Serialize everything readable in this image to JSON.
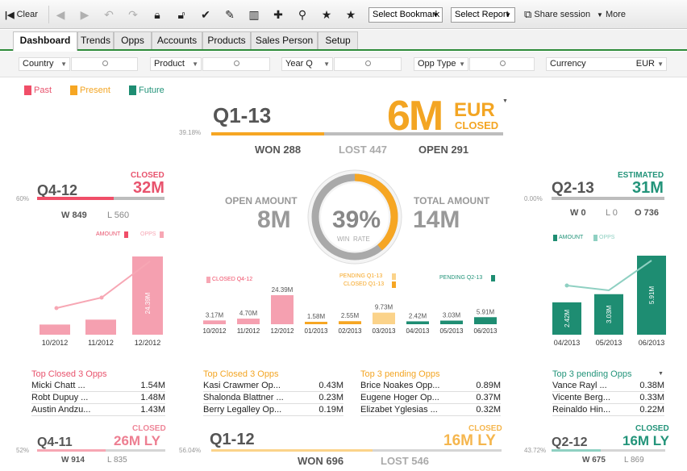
{
  "toolbar": {
    "clear": "Clear",
    "bookmark": "Select Bookmark",
    "report": "Select Report",
    "share": "Share session",
    "more": "More"
  },
  "tabs": [
    "Dashboard",
    "Trends",
    "Opps",
    "Accounts",
    "Products",
    "Sales Person",
    "Setup"
  ],
  "filters": {
    "country": "Country",
    "product": "Product",
    "year": "Year Q",
    "opptype": "Opp Type",
    "currency": "Currency",
    "currency_val": "EUR"
  },
  "legend": {
    "past": "Past",
    "present": "Present",
    "future": "Future",
    "past_color": "#f04e68",
    "present_color": "#f6a623",
    "future_color": "#1e8d72"
  },
  "center": {
    "q": "Q1-13",
    "pct": "39.18%",
    "amount": "6M",
    "cur": "EUR",
    "status": "CLOSED",
    "won": "WON 288",
    "lost": "LOST 447",
    "open": "OPEN 291",
    "open_label": "OPEN AMOUNT",
    "open_val": "8M",
    "total_label": "TOTAL AMOUNT",
    "total_val": "14M",
    "win": "39%",
    "win_rate": "WIN  RATE"
  },
  "left": {
    "q": "Q4-12",
    "pct": "60%",
    "status": "CLOSED",
    "amount": "32M",
    "w": "W 849",
    "l": "L 560",
    "amount_lbl": "AMOUNT",
    "opps_lbl": "OPPS"
  },
  "right": {
    "q": "Q2-13",
    "pct": "0.00%",
    "status": "ESTIMATED",
    "amount": "31M",
    "w": "W 0",
    "l": "L 0",
    "o": "O 736",
    "amount_lbl": "AMOUNT",
    "opps_lbl": "OPPS"
  },
  "left_chart": {
    "categories": [
      "10/2012",
      "11/2012",
      "12/2012"
    ],
    "values": [
      3.17,
      4.7,
      24.39
    ],
    "label": "24.39M"
  },
  "right_chart": {
    "categories": [
      "04/2013",
      "05/2013",
      "06/2013"
    ],
    "values": [
      2.42,
      3.03,
      5.91
    ],
    "labels": [
      "2.42M",
      "3.03M",
      "5.91M"
    ]
  },
  "mid_chart": {
    "closed_q4": "CLOSED Q4-12",
    "pending_q1": "PENDING Q1-13",
    "closed_q1": "CLOSED Q1-13",
    "pending_q2": "PENDING Q2-13",
    "categories": [
      "10/2012",
      "11/2012",
      "12/2012",
      "01/2013",
      "02/2013",
      "03/2013",
      "04/2013",
      "05/2013",
      "06/2013"
    ],
    "values": [
      "3.17M",
      "4.70M",
      "24.39M",
      "1.58M",
      "2.55M",
      "9.73M",
      "2.42M",
      "3.03M",
      "5.91M"
    ]
  },
  "lists": {
    "l1": {
      "title": "Top Closed 3 Opps",
      "rows": [
        [
          "Micki  Chatt ...",
          "1.54M"
        ],
        [
          "Robt  Dupuy ...",
          "1.48M"
        ],
        [
          "Austin  Andzu...",
          "1.43M"
        ]
      ]
    },
    "l2": {
      "title": "Top Closed 3 Opps",
      "rows": [
        [
          "Kasi  Crawmer Op...",
          "0.43M"
        ],
        [
          "Shalonda  Blattner ...",
          "0.23M"
        ],
        [
          "Berry  Legalley Op...",
          "0.19M"
        ]
      ]
    },
    "l3": {
      "title": "Top 3 pending Opps",
      "rows": [
        [
          "Brice  Noakes Opp...",
          "0.89M"
        ],
        [
          "Eugene  Hoger Op...",
          "0.37M"
        ],
        [
          "Elizabet  Yglesias ...",
          "0.32M"
        ]
      ]
    },
    "l4": {
      "title": "Top 3 pending Opps",
      "rows": [
        [
          "Vance  Rayl ...",
          "0.38M"
        ],
        [
          "Vicente  Berg...",
          "0.33M"
        ],
        [
          "Reinaldo  Hin...",
          "0.22M"
        ]
      ]
    }
  },
  "bottom": {
    "b1": {
      "pct": "52%",
      "q": "Q4-11",
      "status": "CLOSED",
      "amount": "26M LY",
      "w": "W 914",
      "l": "L 835"
    },
    "b2": {
      "pct": "56.04%",
      "q": "Q1-12",
      "status": "CLOSED",
      "amount": "16M LY",
      "won": "WON 696",
      "lost": "LOST 546"
    },
    "b3": {
      "pct": "43.72%",
      "q": "Q2-12",
      "status": "CLOSED",
      "amount": "16M LY",
      "w": "W 675",
      "l": "L 869"
    }
  }
}
